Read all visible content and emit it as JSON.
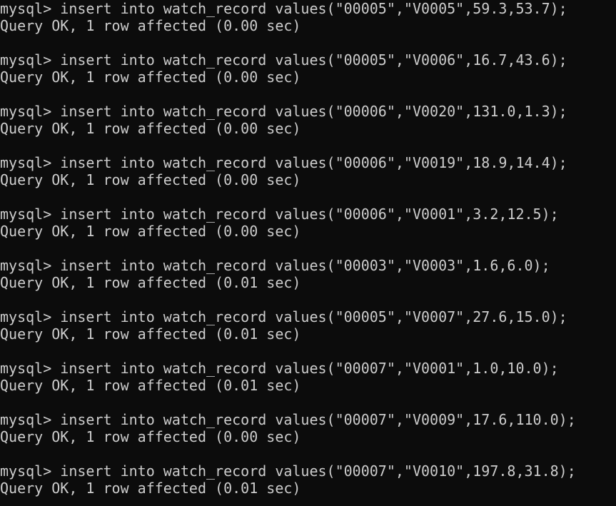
{
  "terminal": {
    "entries": [
      {
        "command": "mysql> insert into watch_record values(\"00005\",\"V0005\",59.3,53.7);",
        "result": "Query OK, 1 row affected (0.00 sec)"
      },
      {
        "command": "mysql> insert into watch_record values(\"00005\",\"V0006\",16.7,43.6);",
        "result": "Query OK, 1 row affected (0.00 sec)"
      },
      {
        "command": "mysql> insert into watch_record values(\"00006\",\"V0020\",131.0,1.3);",
        "result": "Query OK, 1 row affected (0.00 sec)"
      },
      {
        "command": "mysql> insert into watch_record values(\"00006\",\"V0019\",18.9,14.4);",
        "result": "Query OK, 1 row affected (0.00 sec)"
      },
      {
        "command": "mysql> insert into watch_record values(\"00006\",\"V0001\",3.2,12.5);",
        "result": "Query OK, 1 row affected (0.00 sec)"
      },
      {
        "command": "mysql> insert into watch_record values(\"00003\",\"V0003\",1.6,6.0);",
        "result": "Query OK, 1 row affected (0.01 sec)"
      },
      {
        "command": "mysql> insert into watch_record values(\"00005\",\"V0007\",27.6,15.0);",
        "result": "Query OK, 1 row affected (0.01 sec)"
      },
      {
        "command": "mysql> insert into watch_record values(\"00007\",\"V0001\",1.0,10.0);",
        "result": "Query OK, 1 row affected (0.01 sec)"
      },
      {
        "command": "mysql> insert into watch_record values(\"00007\",\"V0009\",17.6,110.0);",
        "result": "Query OK, 1 row affected (0.00 sec)"
      },
      {
        "command": "mysql> insert into watch_record values(\"00007\",\"V0010\",197.8,31.8);",
        "result": "Query OK, 1 row affected (0.01 sec)"
      }
    ]
  },
  "colors": {
    "background": "#0c0c0c",
    "text": "#cccccc"
  }
}
